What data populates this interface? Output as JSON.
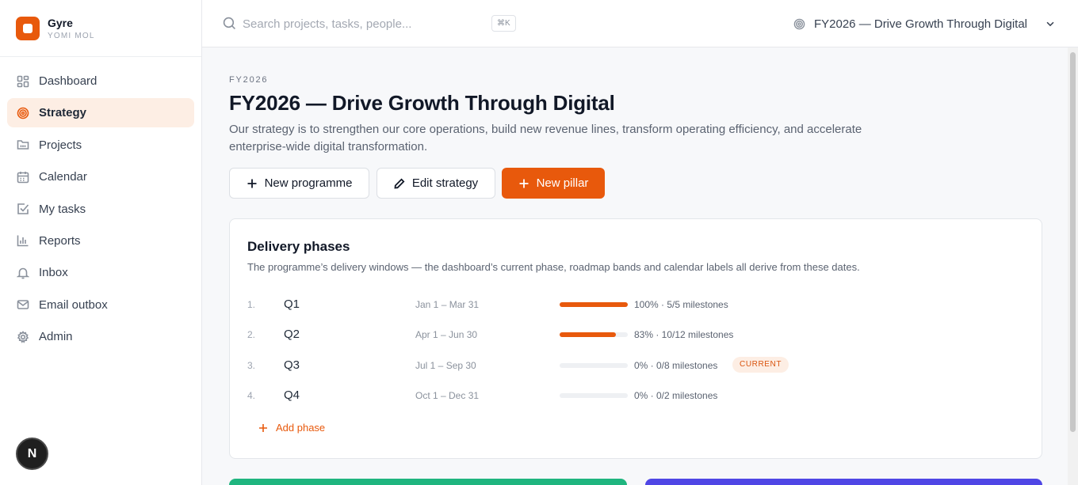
{
  "brand": {
    "name": "Gyre",
    "org": "YOMI MOL",
    "accent": "#e8590c"
  },
  "sidebar": {
    "items": [
      {
        "label": "Dashboard",
        "icon": "dashboard-icon"
      },
      {
        "label": "Strategy",
        "icon": "target-icon",
        "active": true
      },
      {
        "label": "Projects",
        "icon": "folder-icon"
      },
      {
        "label": "Calendar",
        "icon": "calendar-icon"
      },
      {
        "label": "My tasks",
        "icon": "checkbox-icon"
      },
      {
        "label": "Reports",
        "icon": "bar-chart-icon"
      },
      {
        "label": "Inbox",
        "icon": "bell-icon"
      },
      {
        "label": "Email outbox",
        "icon": "mail-icon"
      },
      {
        "label": "Admin",
        "icon": "gear-icon"
      }
    ],
    "user_initial": "N"
  },
  "topbar": {
    "search_placeholder": "Search projects, tasks, people...",
    "shortcut": "⌘K",
    "strategy_selector": "FY2026 — Drive Growth Through Digital"
  },
  "page": {
    "eyebrow": "FY2026",
    "title": "FY2026 — Drive Growth Through Digital",
    "description": "Our strategy is to strengthen our core operations, build new revenue lines, transform operating efficiency, and accelerate enterprise-wide digital transformation."
  },
  "actions": {
    "new_programme": "New programme",
    "edit_strategy": "Edit strategy",
    "new_pillar": "New pillar"
  },
  "phases_card": {
    "title": "Delivery phases",
    "subtitle": "The programme’s delivery windows — the dashboard’s current phase, roadmap bands and calendar labels all derive from these dates.",
    "phases": [
      {
        "num": "1.",
        "name": "Q1",
        "dates": "Jan 1 – Mar 31",
        "progress": 100,
        "stat": "100% · 5/5 milestones",
        "badge": ""
      },
      {
        "num": "2.",
        "name": "Q2",
        "dates": "Apr 1 – Jun 30",
        "progress": 83,
        "stat": "83% · 10/12 milestones",
        "badge": ""
      },
      {
        "num": "3.",
        "name": "Q3",
        "dates": "Jul 1 – Sep 30",
        "progress": 0,
        "stat": "0% · 0/8 milestones",
        "badge": "CURRENT"
      },
      {
        "num": "4.",
        "name": "Q4",
        "dates": "Oct 1 – Dec 31",
        "progress": 0,
        "stat": "0% · 0/2 milestones",
        "badge": ""
      }
    ],
    "add_label": "Add phase"
  },
  "colors": {
    "pillar_green": "#1fb57f",
    "pillar_indigo": "#4f46e5"
  }
}
